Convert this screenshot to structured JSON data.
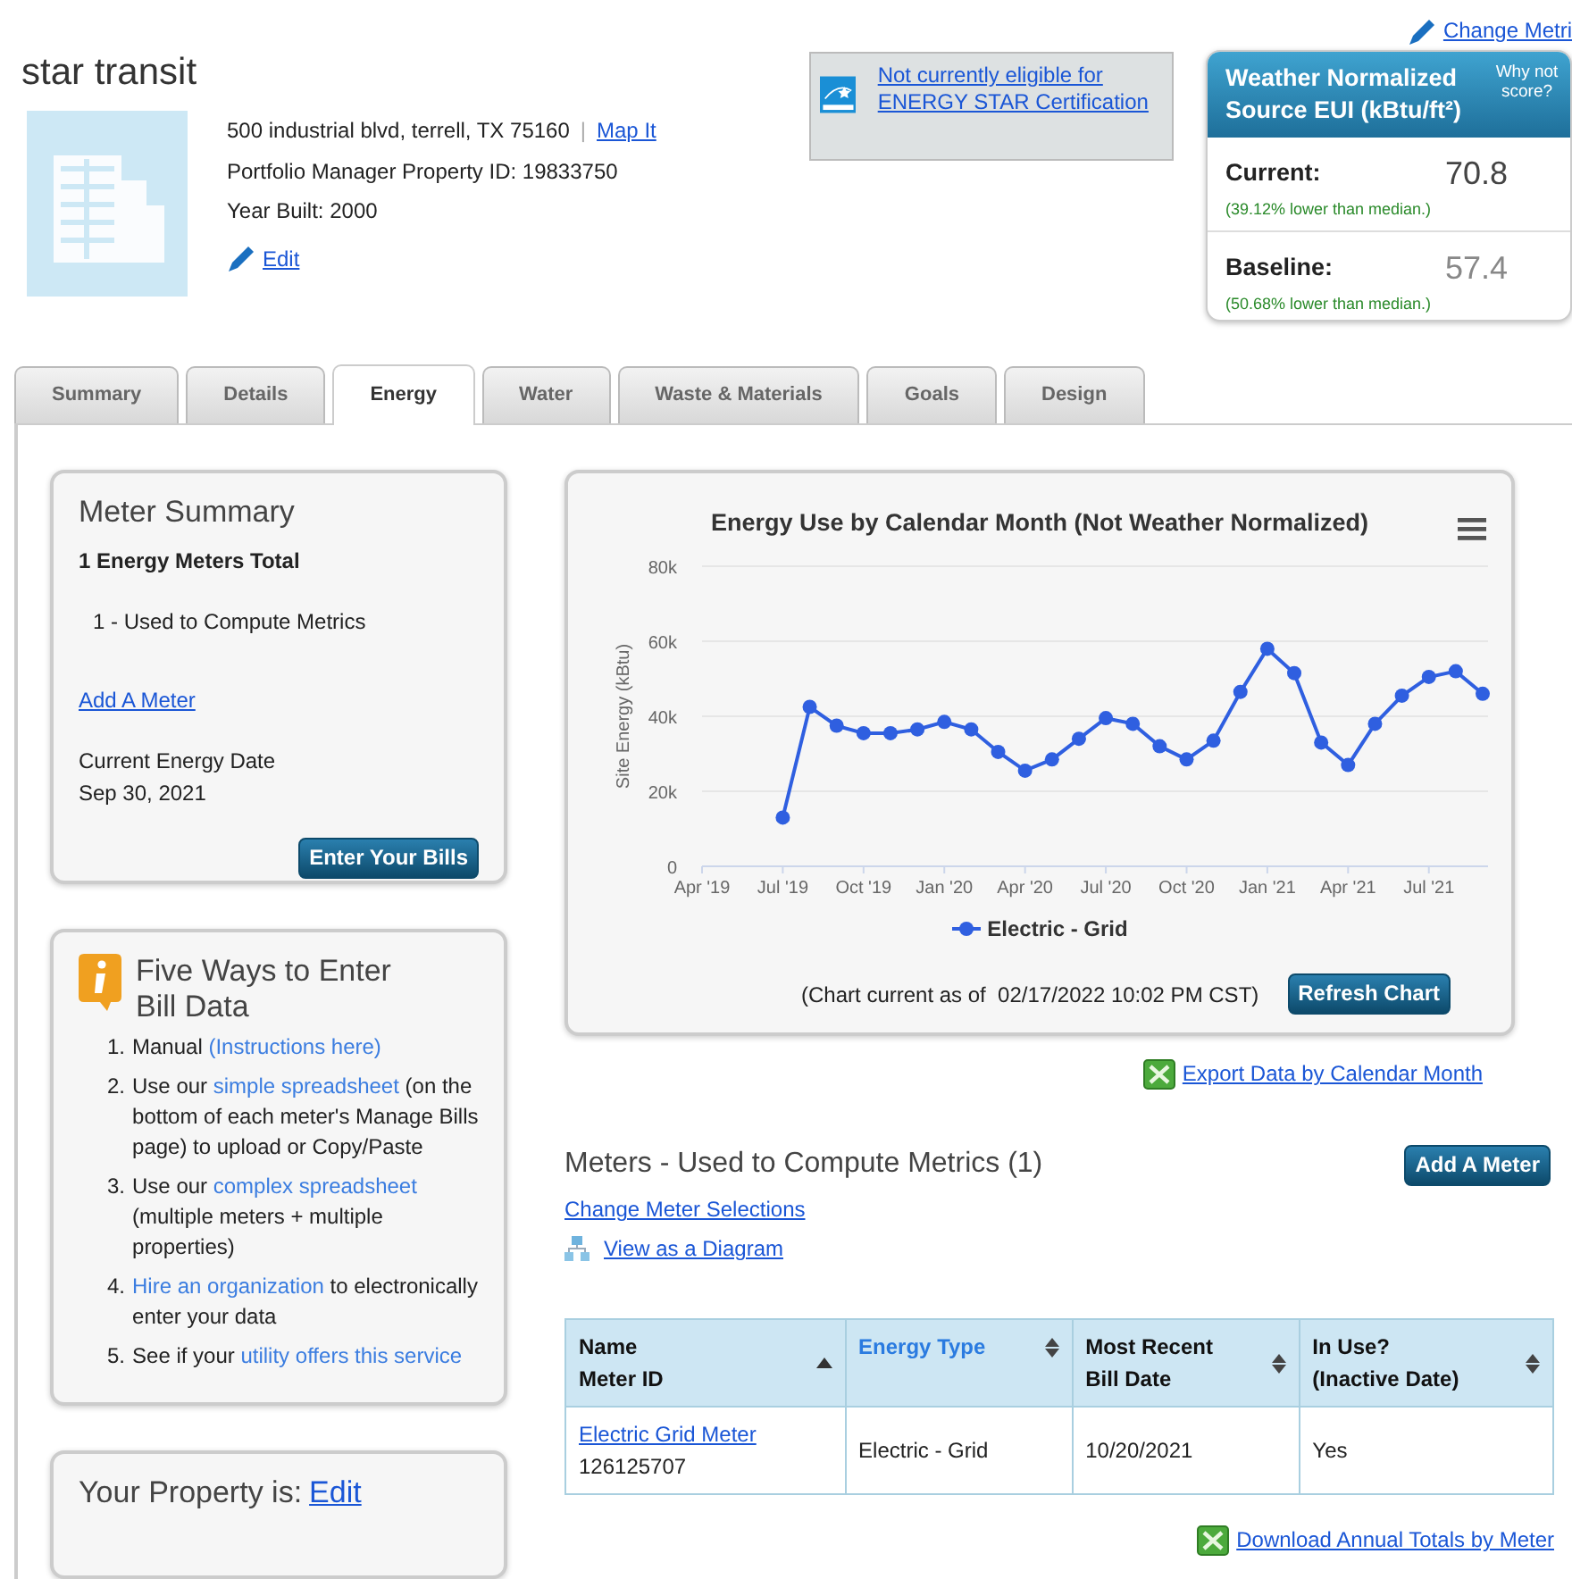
{
  "header": {
    "change_metrics_link": "Change Metri",
    "property_name": "star transit",
    "address": "500 industrial blvd, terrell, TX 75160",
    "separator": "|",
    "map_link": "Map It",
    "property_id": "Portfolio Manager Property ID: 19833750",
    "year_built": "Year Built: 2000",
    "edit_link": "Edit"
  },
  "energy_star": {
    "link": "Not currently eligible for ENERGY STAR Certification"
  },
  "eui_card": {
    "title": "Weather Normalized Source EUI (kBtu/ft²)",
    "why_link": "Why not score?",
    "metrics": [
      {
        "label": "Current:",
        "value": "70.8",
        "note": "(39.12% lower than median.)",
        "dimmed": false
      },
      {
        "label": "Baseline:",
        "value": "57.4",
        "note": "(50.68% lower than median.)",
        "dimmed": true
      }
    ]
  },
  "tabs": [
    {
      "label": "Summary",
      "selected": false
    },
    {
      "label": "Details",
      "selected": false
    },
    {
      "label": "Energy",
      "selected": true
    },
    {
      "label": "Water",
      "selected": false
    },
    {
      "label": "Waste & Materials",
      "selected": false
    },
    {
      "label": "Goals",
      "selected": false
    },
    {
      "label": "Design",
      "selected": false
    }
  ],
  "meter_summary": {
    "title": "Meter Summary",
    "total": "1 Energy Meters Total",
    "used": "1 - Used to Compute Metrics",
    "add_link": "Add A Meter",
    "date_label": "Current Energy Date",
    "date_value": "Sep 30, 2021",
    "button": "Enter Your Bills"
  },
  "five_ways": {
    "title": "Five Ways to Enter Bill Data",
    "items": [
      {
        "number": "1.",
        "segments": [
          {
            "text": "Manual ",
            "kind": "text"
          },
          {
            "text": "(Instructions here)",
            "kind": "link"
          }
        ]
      },
      {
        "number": "2.",
        "segments": [
          {
            "text": "Use our ",
            "kind": "text"
          },
          {
            "text": "simple spreadsheet",
            "kind": "link"
          },
          {
            "text": " (on the bottom of each meter's Manage Bills page) to upload or Copy/Paste",
            "kind": "text"
          }
        ]
      },
      {
        "number": "3.",
        "segments": [
          {
            "text": "Use our ",
            "kind": "text"
          },
          {
            "text": "complex spreadsheet",
            "kind": "link"
          },
          {
            "text": " (multiple meters + multiple properties)",
            "kind": "text"
          }
        ]
      },
      {
        "number": "4.",
        "segments": [
          {
            "text": "Hire an organization",
            "kind": "link"
          },
          {
            "text": " to electronically enter your data",
            "kind": "text"
          }
        ]
      },
      {
        "number": "5.",
        "segments": [
          {
            "text": "See if your ",
            "kind": "text"
          },
          {
            "text": "utility offers this service",
            "kind": "link"
          }
        ]
      }
    ]
  },
  "property_card": {
    "title": "Your Property is:",
    "edit_link": "Edit"
  },
  "chart": {
    "chart_data": {
      "type": "line",
      "title": "Energy Use by Calendar Month (Not Weather Normalized)",
      "ylabel": "Site Energy (kBtu)",
      "categories": [
        "Apr '19",
        null,
        null,
        "Jul '19",
        null,
        null,
        "Oct '19",
        null,
        null,
        "Jan '20",
        null,
        null,
        "Apr '20",
        null,
        null,
        "Jul '20",
        null,
        null,
        "Oct '20",
        null,
        null,
        "Jan '21",
        null,
        null,
        "Apr '21",
        null,
        null,
        "Jul '21",
        null,
        null
      ],
      "series": [
        {
          "name": "Electric - Grid",
          "color": "#2f5fe0",
          "marker": "circle",
          "values": [
            null,
            null,
            null,
            13000,
            42500,
            37500,
            35500,
            35500,
            36500,
            38500,
            36500,
            30500,
            25500,
            28500,
            34000,
            39500,
            38000,
            32000,
            28500,
            33500,
            46500,
            58000,
            51500,
            33000,
            27000,
            38000,
            45500,
            50500,
            52000,
            46000
          ]
        }
      ],
      "ylim": [
        0,
        80000
      ],
      "grid": true,
      "yticks": [
        {
          "value": 0,
          "label": "0"
        },
        {
          "value": 20000,
          "label": "20k"
        },
        {
          "value": 40000,
          "label": "40k"
        },
        {
          "value": 60000,
          "label": "60k"
        },
        {
          "value": 80000,
          "label": "80k"
        }
      ]
    },
    "footer": "(Chart current as of  02/17/2022 10:02 PM CST)",
    "refresh_button": "Refresh Chart",
    "export_link": "Export Data by Calendar Month"
  },
  "meters": {
    "title": "Meters - Used to Compute Metrics (1)",
    "add_button": "Add A Meter",
    "change_link": "Change Meter Selections",
    "diagram_link": "View as a Diagram",
    "table": {
      "columns": [
        {
          "lines": [
            "Name",
            "Meter ID"
          ],
          "sorted": true,
          "highlighted": false
        },
        {
          "lines": [
            "Energy Type"
          ],
          "sorted": false,
          "highlighted": true
        },
        {
          "lines": [
            "Most Recent",
            "Bill Date"
          ],
          "sorted": false,
          "highlighted": false
        },
        {
          "lines": [
            "In Use?",
            "(Inactive Date)"
          ],
          "sorted": false,
          "highlighted": false
        }
      ],
      "rows": [
        {
          "name_link": "Electric Grid Meter",
          "meter_id": "126125707",
          "energy_type": "Electric - Grid",
          "bill_date": "10/20/2021",
          "in_use": "Yes"
        }
      ]
    },
    "download_link": "Download Annual Totals by Meter"
  }
}
